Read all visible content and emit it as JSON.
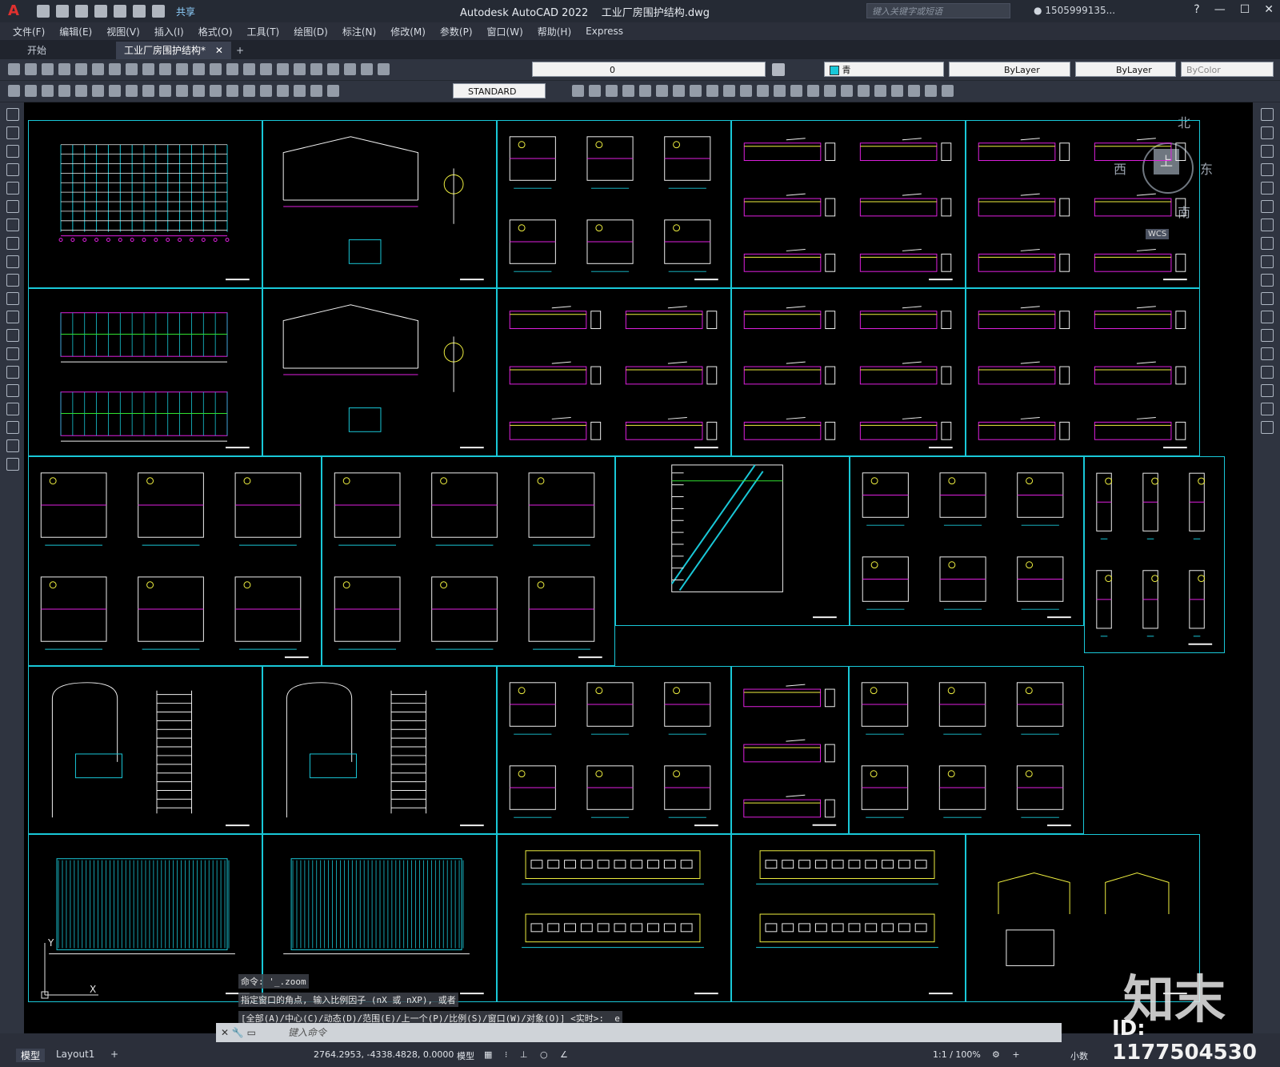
{
  "app": {
    "title": "Autodesk AutoCAD 2022",
    "filename": "工业厂房围护结构.dwg",
    "share_label": "共享",
    "search_placeholder": "键入关键字或短语",
    "user_label": "1505999135..."
  },
  "menu": [
    "文件(F)",
    "编辑(E)",
    "视图(V)",
    "插入(I)",
    "格式(O)",
    "工具(T)",
    "绘图(D)",
    "标注(N)",
    "修改(M)",
    "参数(P)",
    "窗口(W)",
    "帮助(H)",
    "Express"
  ],
  "doc_tabs": [
    {
      "label": "开始",
      "active": false
    },
    {
      "label": "工业厂房围护结构*",
      "active": true
    }
  ],
  "toolbar": {
    "layer_value": "0",
    "color_value": "青",
    "linetype_value": "ByLayer",
    "lineweight_value": "ByLayer",
    "plotstyle_value": "ByColor",
    "textstyle_value": "STANDARD"
  },
  "compass": {
    "north": "北",
    "south": "南",
    "east": "东",
    "west": "西",
    "top": "上",
    "ucs": "WCS"
  },
  "command": {
    "history": [
      "命令: '_.zoom",
      "指定窗口的角点, 输入比例因子 (nX 或 nXP), 或者",
      "[全部(A)/中心(C)/动态(D)/范围(E)/上一个(P)/比例(S)/窗口(W)/对象(O)] <实时>: _e"
    ],
    "input_placeholder": "键入命令"
  },
  "status": {
    "model_tab": "模型",
    "layout_tab": "Layout1",
    "coordinates": "2764.2953, -4338.4828, 0.0000",
    "space_label": "模型",
    "scale": "1:1 / 100%",
    "units": "小数"
  },
  "watermark": {
    "brand": "知末",
    "id": "ID: 1177504530"
  },
  "colors": {
    "cyan": "#19c8d8",
    "magenta": "#e020e0",
    "yellow": "#f0f040",
    "white": "#f0f0f0",
    "green": "#30e030",
    "canvas": "#000000"
  }
}
